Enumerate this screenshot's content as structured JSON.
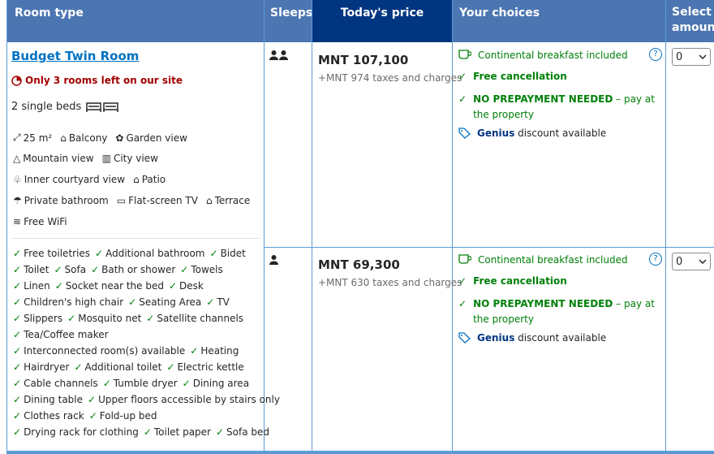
{
  "headers": {
    "room_type": "Room type",
    "sleeps": "Sleeps",
    "price": "Today's price",
    "choices": "Your choices",
    "select_1": "Select",
    "select_2": "amount"
  },
  "room": {
    "name": "Budget Twin Room",
    "scarcity": "Only 3 rooms left on our site",
    "beds": "2 single beds",
    "facilities": [
      [
        "25 m²",
        "Balcony",
        "Garden view"
      ],
      [
        "Mountain view",
        "City view"
      ],
      [
        "Inner courtyard view",
        "Patio"
      ],
      [
        "Private bathroom",
        "Flat-screen TV",
        "Terrace"
      ],
      [
        "Free WiFi"
      ]
    ],
    "amenities": [
      [
        "Free toiletries",
        "Additional bathroom",
        "Bidet"
      ],
      [
        "Toilet",
        "Sofa",
        "Bath or shower",
        "Towels"
      ],
      [
        "Linen",
        "Socket near the bed",
        "Desk"
      ],
      [
        "Children's high chair",
        "Seating Area",
        "TV"
      ],
      [
        "Slippers",
        "Mosquito net",
        "Satellite channels"
      ],
      [
        "Tea/Coffee maker"
      ],
      [
        "Interconnected room(s) available",
        "Heating"
      ],
      [
        "Hairdryer",
        "Additional toilet",
        "Electric kettle"
      ],
      [
        "Cable channels",
        "Tumble dryer",
        "Dining area"
      ],
      [
        "Dining table",
        "Upper floors accessible by stairs only"
      ],
      [
        "Clothes rack",
        "Fold-up bed"
      ],
      [
        "Drying rack for clothing",
        "Toilet paper",
        "Sofa bed"
      ]
    ]
  },
  "options": [
    {
      "sleeps": 2,
      "price": "MNT 107,100",
      "taxes": "+MNT 974 taxes and charges",
      "breakfast": "Continental breakfast included",
      "cancellation": "Free cancellation",
      "prepay_bold": "NO PREPAYMENT NEEDED",
      "prepay_rest": " – pay at the property",
      "genius_bold": "Genius",
      "genius_rest": " discount available",
      "info": "?",
      "select_value": "0"
    },
    {
      "sleeps": 1,
      "price": "MNT 69,300",
      "taxes": "+MNT 630 taxes and charges",
      "breakfast": "Continental breakfast included",
      "cancellation": "Free cancellation",
      "prepay_bold": "NO PREPAYMENT NEEDED",
      "prepay_rest": " – pay at the property",
      "genius_bold": "Genius",
      "genius_rest": " discount available",
      "info": "?",
      "select_value": "0"
    }
  ]
}
